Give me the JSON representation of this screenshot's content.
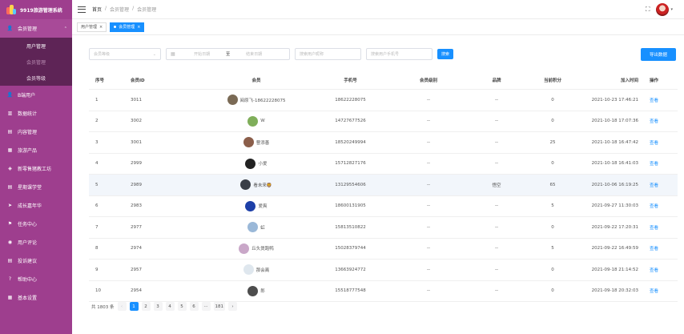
{
  "app": {
    "title": "9919旅游管理系统"
  },
  "sidebar": {
    "items": [
      {
        "label": "会员管理",
        "icon": "user-icon",
        "open": true
      },
      {
        "label": "B端用户",
        "icon": "user-icon"
      },
      {
        "label": "数据统计",
        "icon": "chart-icon"
      },
      {
        "label": "内容管理",
        "icon": "document-icon"
      },
      {
        "label": "旅游产品",
        "icon": "grid-icon"
      },
      {
        "label": "新零售猪教工坊",
        "icon": "tag-icon"
      },
      {
        "label": "星期课学堂",
        "icon": "document-icon"
      },
      {
        "label": "成长嘉年华",
        "icon": "send-icon"
      },
      {
        "label": "任务中心",
        "icon": "flag-icon"
      },
      {
        "label": "用户评论",
        "icon": "comment-icon"
      },
      {
        "label": "投诉建议",
        "icon": "document-icon"
      },
      {
        "label": "帮助中心",
        "icon": "help-icon"
      },
      {
        "label": "基本设置",
        "icon": "grid-icon"
      }
    ],
    "sub_items": [
      {
        "label": "用户管理"
      },
      {
        "label": "会员管理"
      },
      {
        "label": "会员等级"
      }
    ]
  },
  "header": {
    "breadcrumb": [
      "首页",
      "/",
      "会员管理",
      "/",
      "会员管理"
    ]
  },
  "tags": [
    {
      "label": "用户管理",
      "close": "×"
    },
    {
      "label": "会员管理",
      "close": "×"
    }
  ],
  "filter": {
    "level_placeholder": "会员等级",
    "start_placeholder": "开始日期",
    "range_sep": "至",
    "end_placeholder": "结束日期",
    "nickname_placeholder": "搜索用户昵称",
    "phone_placeholder": "搜索用户手机号",
    "search_label": "搜索",
    "export_label": "导出数据"
  },
  "table": {
    "headers": [
      "序号",
      "会员ID",
      "会员",
      "手机号",
      "会员级别",
      "品牌",
      "当前积分",
      "加入时间",
      "操作"
    ],
    "rows": [
      {
        "no": "1",
        "id": "3011",
        "name": "阅原飞-18622228075",
        "phone": "18622228075",
        "level": "--",
        "brand": "--",
        "points": "0",
        "joined": "2021-10-23 17:46:21",
        "action": "查看",
        "avatar": "#7a6a55"
      },
      {
        "no": "2",
        "id": "3002",
        "name": "W",
        "phone": "14727677526",
        "level": "--",
        "brand": "--",
        "points": "0",
        "joined": "2021-10-18 17:07:36",
        "action": "查看",
        "avatar": "#7fae5a"
      },
      {
        "no": "3",
        "id": "3001",
        "name": "曹添善",
        "phone": "18520249994",
        "level": "--",
        "brand": "--",
        "points": "25",
        "joined": "2021-10-18 16:47:42",
        "action": "查看",
        "avatar": "#8b5e4a"
      },
      {
        "no": "4",
        "id": "2999",
        "name": "小爱",
        "phone": "15712827176",
        "level": "--",
        "brand": "--",
        "points": "0",
        "joined": "2021-10-18 16:41:03",
        "action": "查看",
        "avatar": "#222222"
      },
      {
        "no": "5",
        "id": "2989",
        "name": "看未来🦁",
        "phone": "13129554606",
        "level": "--",
        "brand": "悟空",
        "points": "65",
        "joined": "2021-10-06 16:19:25",
        "action": "查看",
        "avatar": "#3a3f48"
      },
      {
        "no": "6",
        "id": "2983",
        "name": "爱爽",
        "phone": "18600131905",
        "level": "--",
        "brand": "--",
        "points": "5",
        "joined": "2021-09-27 11:30:03",
        "action": "查看",
        "avatar": "#1d3fa8"
      },
      {
        "no": "7",
        "id": "2977",
        "name": "虹",
        "phone": "15813510822",
        "level": "--",
        "brand": "--",
        "points": "0",
        "joined": "2021-09-22 17:20:31",
        "action": "查看",
        "avatar": "#9ab8d8"
      },
      {
        "no": "8",
        "id": "2974",
        "name": "丘头煲跑鸭",
        "phone": "15028379744",
        "level": "--",
        "brand": "--",
        "points": "5",
        "joined": "2021-09-22 16:49:59",
        "action": "查看",
        "avatar": "#c9a7c8"
      },
      {
        "no": "9",
        "id": "2957",
        "name": "那会离",
        "phone": "13663924772",
        "level": "--",
        "brand": "--",
        "points": "0",
        "joined": "2021-09-18 21:14:52",
        "action": "查看",
        "avatar": "#dfe7ee"
      },
      {
        "no": "10",
        "id": "2954",
        "name": "郎",
        "phone": "15518777548",
        "level": "--",
        "brand": "--",
        "points": "0",
        "joined": "2021-09-18 20:32:03",
        "action": "查看",
        "avatar": "#4d4d4d"
      }
    ]
  },
  "pagination": {
    "total": "共 1803 条",
    "prev": "‹",
    "pages": [
      "1",
      "2",
      "3",
      "4",
      "5",
      "6"
    ],
    "ellipsis": "···",
    "last": "181",
    "next": "›",
    "current": "1"
  },
  "colors": {
    "sidebar": "#9e3e8e",
    "sidebar_sub": "#5e2456",
    "accent": "#1890ff"
  }
}
